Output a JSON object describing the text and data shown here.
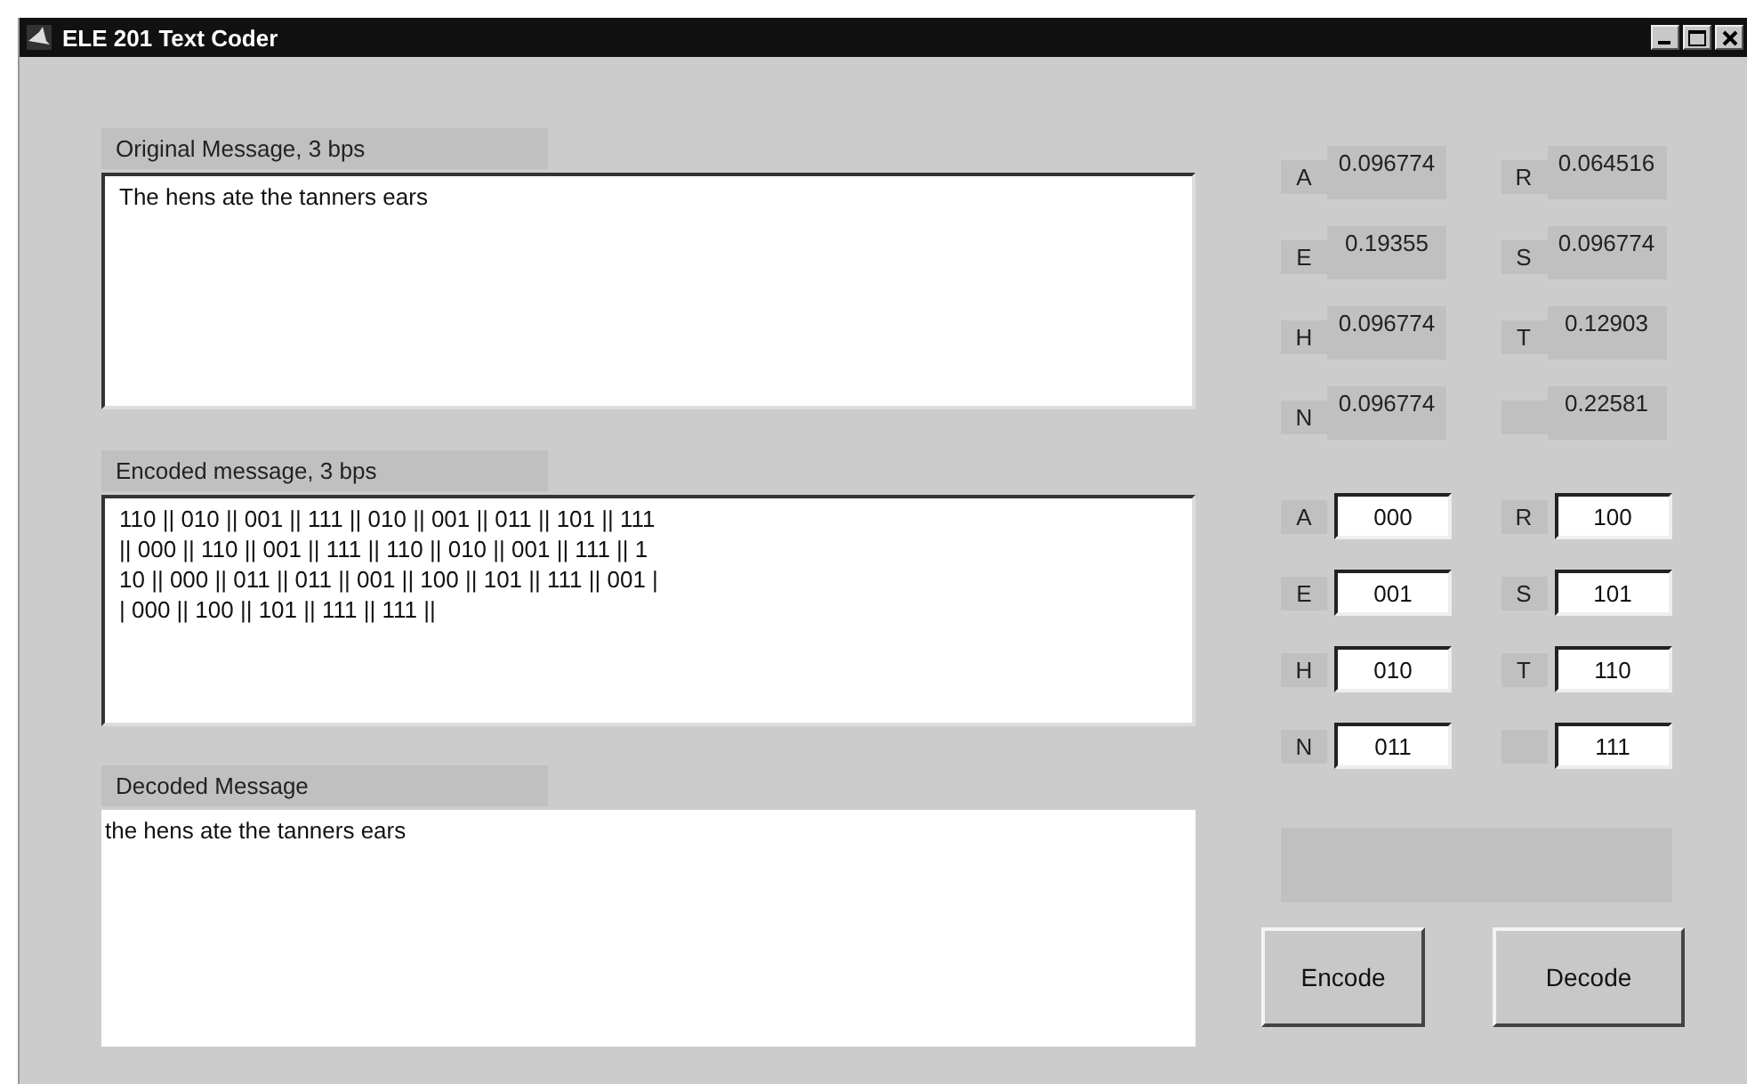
{
  "window": {
    "title": "ELE 201 Text Coder"
  },
  "original": {
    "label": "Original Message, 3 bps",
    "value": "The hens ate the tanners ears"
  },
  "encoded": {
    "label": "Encoded message, 3 bps",
    "lines": [
      "110 || 010 || 001 || 111 || 010 || 001 || 011 || 101 || 111",
      "|| 000 || 110 || 001 || 111 || 110 || 010 || 001 || 111 || 1",
      "10 || 000 || 011 || 011 || 001 || 100 || 101 || 111 || 001 |",
      "| 000 || 100 || 101 || 111 || 111 ||"
    ]
  },
  "decoded": {
    "label": "Decoded Message",
    "value": "the hens ate the tanners ears"
  },
  "frequencies": [
    {
      "letter": "A",
      "value": "0.096774"
    },
    {
      "letter": "R",
      "value": "0.064516"
    },
    {
      "letter": "E",
      "value": "0.19355"
    },
    {
      "letter": "S",
      "value": "0.096774"
    },
    {
      "letter": "H",
      "value": "0.096774"
    },
    {
      "letter": "T",
      "value": "0.12903"
    },
    {
      "letter": "N",
      "value": "0.096774"
    },
    {
      "value": "0.22581"
    }
  ],
  "codes": [
    {
      "letter": "A",
      "value": "000"
    },
    {
      "letter": "R",
      "value": "100"
    },
    {
      "letter": "E",
      "value": "001"
    },
    {
      "letter": "S",
      "value": "101"
    },
    {
      "letter": "H",
      "value": "010"
    },
    {
      "letter": "T",
      "value": "110"
    },
    {
      "letter": "N",
      "value": "011"
    },
    {
      "value": "111"
    }
  ],
  "buttons": [
    "Encode",
    "Decode"
  ]
}
